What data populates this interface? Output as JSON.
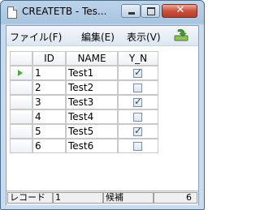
{
  "window": {
    "title": "CREATETB - Tes..."
  },
  "menu": {
    "file": "ファイル(F)",
    "edit": "編集(E)",
    "view": "表示(V)"
  },
  "columns": [
    "ID",
    "NAME",
    "Y_N"
  ],
  "rows": [
    {
      "id": "1",
      "name": "Test1",
      "yn": true
    },
    {
      "id": "2",
      "name": "Test2",
      "yn": false
    },
    {
      "id": "3",
      "name": "Test3",
      "yn": true
    },
    {
      "id": "4",
      "name": "Test4",
      "yn": false
    },
    {
      "id": "5",
      "name": "Test5",
      "yn": true
    },
    {
      "id": "6",
      "name": "Test6",
      "yn": false
    }
  ],
  "current_row": 0,
  "status": {
    "record_label": "レコード",
    "record_value": "1",
    "candidate_label": "候補",
    "candidate_value": "6"
  },
  "icons": {
    "toolbar": "refresh-download-icon",
    "current_row": "current-row-arrow-icon",
    "window": "document-icon"
  },
  "colors": {
    "accent_green": "#4cae3a",
    "title_gradient": "#bcd3ea",
    "close_button": "#c7523c"
  }
}
